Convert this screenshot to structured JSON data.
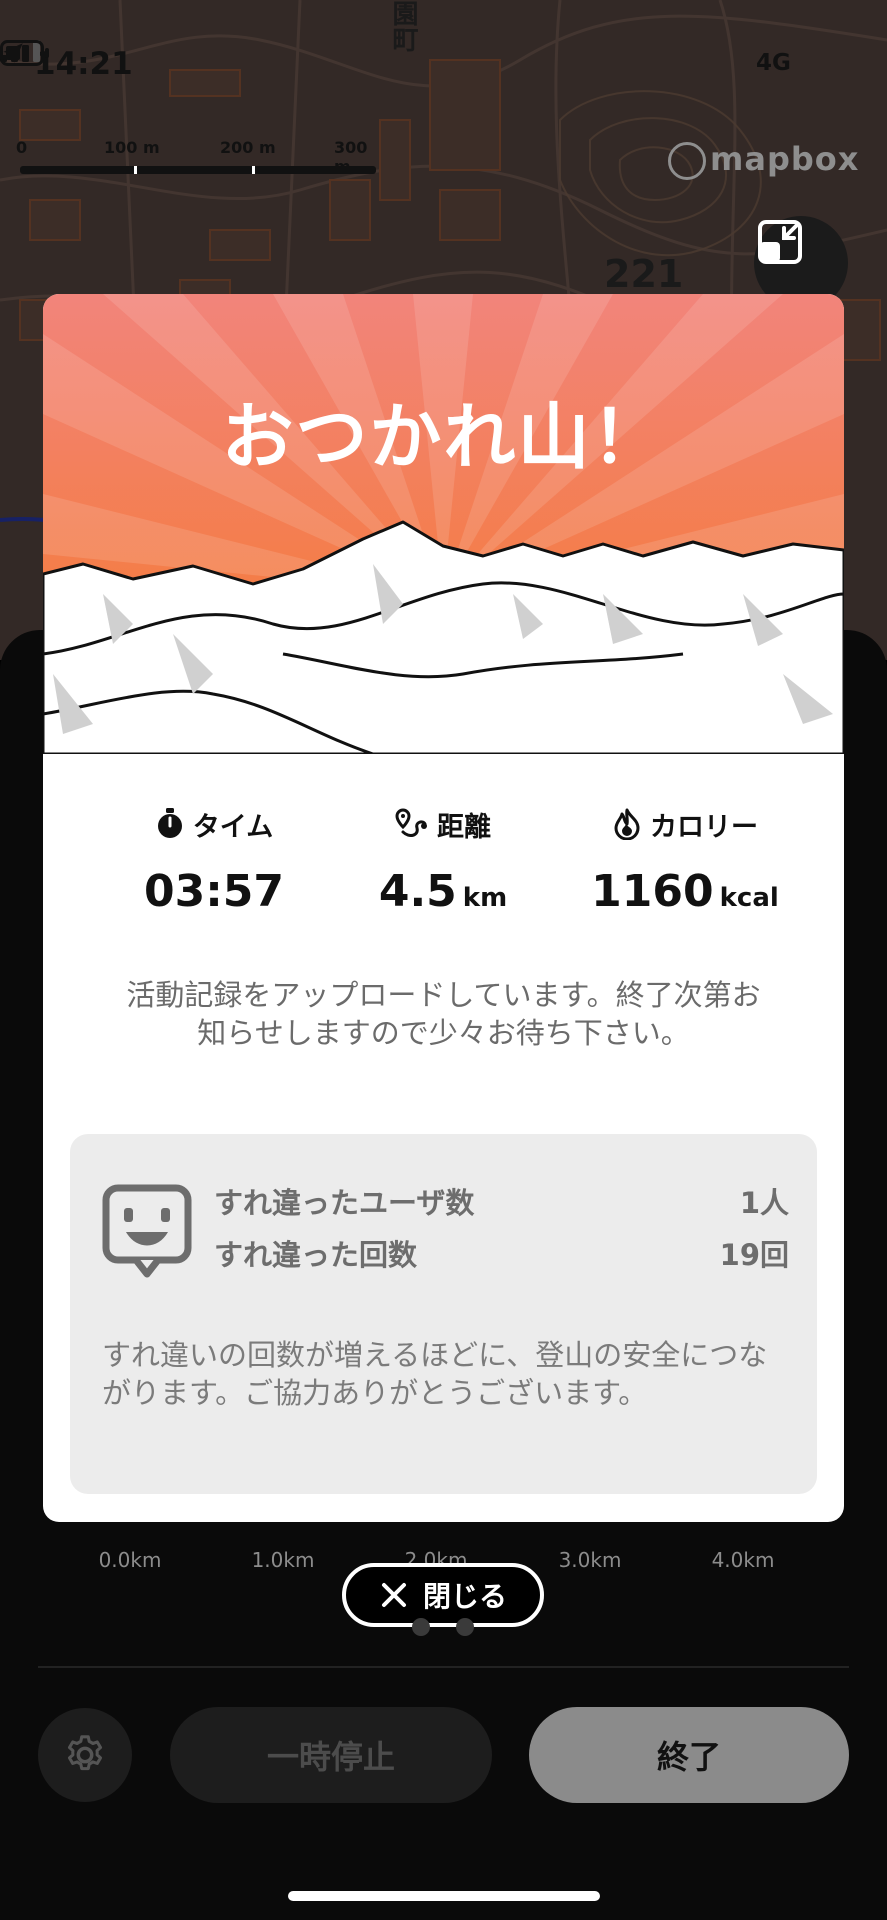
{
  "status_bar": {
    "time": "14:21",
    "network": "4G"
  },
  "map": {
    "scale_labels": [
      "0",
      "100 m",
      "200 m",
      "300 m"
    ],
    "attribution": "mapbox",
    "elevation_label": "221",
    "place_label": "園町"
  },
  "modal": {
    "title": "おつかれ山！",
    "stats": [
      {
        "icon": "stopwatch-icon",
        "label": "タイム",
        "value": "03:57",
        "unit": ""
      },
      {
        "icon": "route-icon",
        "label": "距離",
        "value": "4.5",
        "unit": "km"
      },
      {
        "icon": "flame-icon",
        "label": "カロリー",
        "value": "1160",
        "unit": "kcal"
      }
    ],
    "upload_message": "活動記録をアップロードしています。終了次第お知らせしますので少々お待ち下さい。",
    "encounter": {
      "users_label": "すれ違ったユーザ数",
      "users_value": "1人",
      "count_label": "すれ違った回数",
      "count_value": "19回",
      "note": "すれ違いの回数が増えるほどに、登山の安全につながります。ご協力ありがとうございます。"
    }
  },
  "sheet": {
    "axis_ticks": [
      "0.0km",
      "1.0km",
      "2.0km",
      "3.0km",
      "4.0km"
    ],
    "close_label": "閉じる",
    "pause_label": "一時停止",
    "finish_label": "終了"
  },
  "colors": {
    "hero_top": "#f08478",
    "hero_bottom": "#f47f2a",
    "finish_button": "#8b8b8b"
  }
}
